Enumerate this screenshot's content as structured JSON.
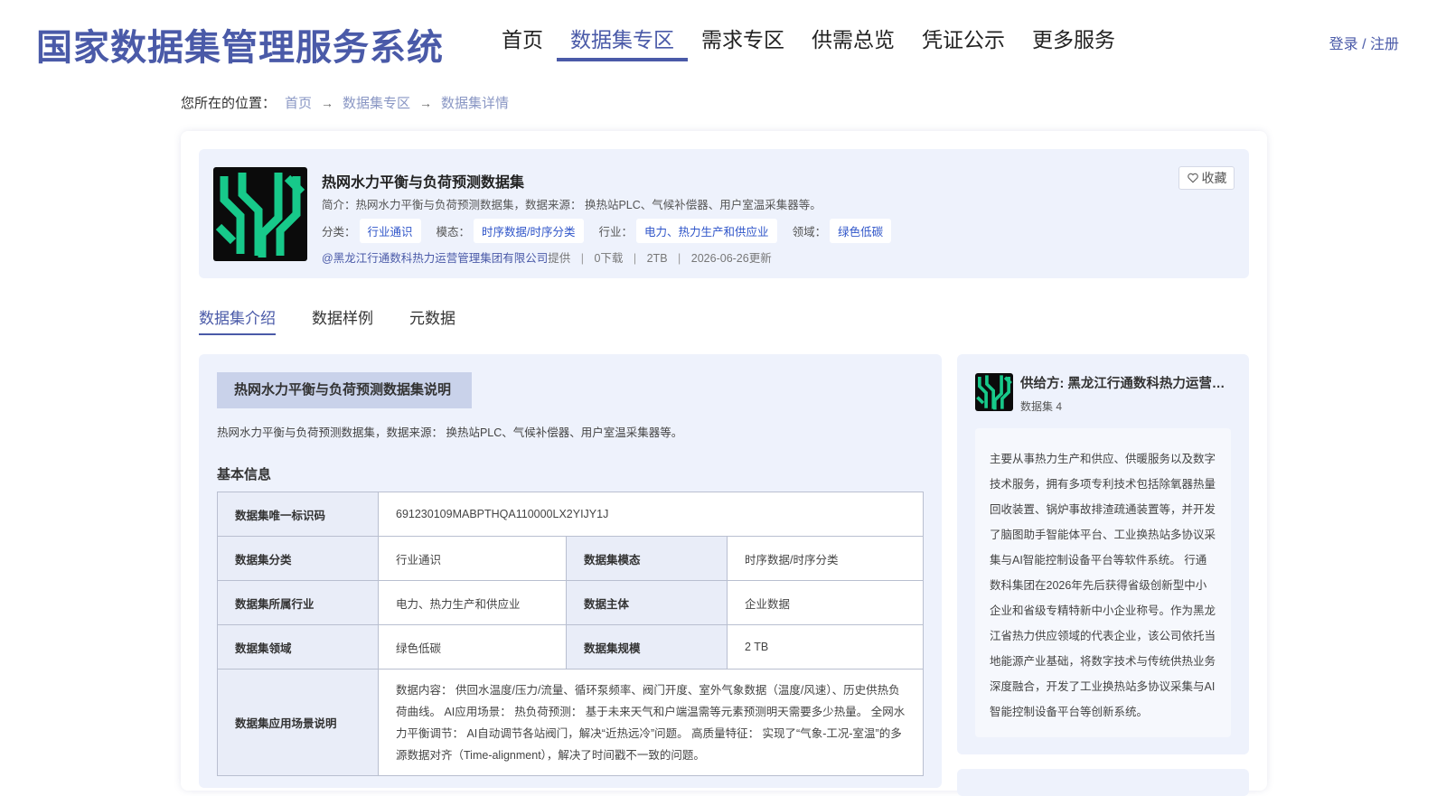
{
  "header": {
    "site_title": "国家数据集管理服务系统",
    "nav": [
      "首页",
      "数据集专区",
      "需求专区",
      "供需总览",
      "凭证公示",
      "更多服务"
    ],
    "active_nav": "数据集专区",
    "login_label": "登录 / 注册"
  },
  "breadcrumb": {
    "prefix": "您所在的位置：",
    "items": [
      "首页",
      "数据集专区",
      "数据集详情"
    ]
  },
  "dataset": {
    "title": "热网水力平衡与负荷预测数据集",
    "intro": "简介：热网水力平衡与负荷预测数据集，数据来源： 换热站PLC、气候补偿器、用户室温采集器等。",
    "tags": [
      {
        "label": "分类：",
        "value": "行业通识"
      },
      {
        "label": "模态：",
        "value": "时序数据/时序分类"
      },
      {
        "label": "行业：",
        "value": "电力、热力生产和供应业"
      },
      {
        "label": "领域：",
        "value": "绿色低碳"
      }
    ],
    "provider": "@黑龙江行通数科热力运营管理集团有限公司",
    "provider_suffix": "提供",
    "downloads": "0下载",
    "size": "2TB",
    "updated": "2026-06-26更新",
    "favorite_label": "收藏"
  },
  "tabs": [
    "数据集介绍",
    "数据样例",
    "元数据"
  ],
  "active_tab": "数据集介绍",
  "intro_section": {
    "title": "热网水力平衡与负荷预测数据集说明",
    "description": "热网水力平衡与负荷预测数据集，数据来源： 换热站PLC、气候补偿器、用户室温采集器等。",
    "basic_title": "基本信息"
  },
  "basic_info": {
    "id_label": "数据集唯一标识码",
    "id_value": "691230109MABPTHQA110000LX2YIJY1J",
    "rows": [
      {
        "k1": "数据集分类",
        "v1": "行业通识",
        "k2": "数据集模态",
        "v2": "时序数据/时序分类"
      },
      {
        "k1": "数据集所属行业",
        "v1": "电力、热力生产和供应业",
        "k2": "数据主体",
        "v2": "企业数据"
      },
      {
        "k1": "数据集领域",
        "v1": "绿色低碳",
        "k2": "数据集规模",
        "v2": "2 TB"
      }
    ],
    "scenario_label": "数据集应用场景说明",
    "scenario_value": "数据内容： 供回水温度/压力/流量、循环泵频率、阀门开度、室外气象数据（温度/风速）、历史供热负荷曲线。 AI应用场景： 热负荷预测： 基于未来天气和户端温需等元素预测明天需要多少热量。 全网水力平衡调节： AI自动调节各站阀门，解决“近热远冷”问题。 高质量特征： 实现了“气象-工况-室温”的多源数据对齐（Time-alignment），解决了时间戳不一致的问题。"
  },
  "provider_card": {
    "name": "供给方: 黑龙江行通数科热力运营管理集团有限公司",
    "count": "数据集 4",
    "description": "主要从事热力生产和供应、供暖服务以及数字技术服务，拥有多项专利技术包括除氧器热量回收装置、锅炉事故排渣疏通装置等，并开发了脑图助手智能体平台、工业换热站多协议采集与AI智能控制设备平台等软件系统。 行通数科集团在2026年先后获得省级创新型中小企业和省级专精特新中小企业称号。作为黑龙江省热力供应领域的代表企业，该公司依托当地能源产业基础，将数字技术与传统供热业务深度融合，开发了工业换热站多协议采集与AI智能控制设备平台等创新系统。"
  },
  "colors": {
    "brand": "#4a5aa8",
    "logo_green": "#17c98a",
    "panel_bg": "#eef2fc"
  }
}
